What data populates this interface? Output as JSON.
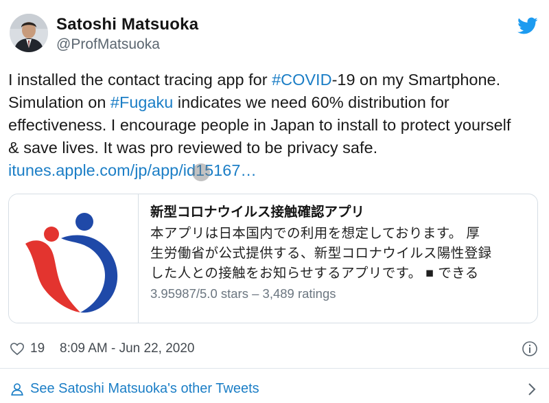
{
  "author": {
    "name": "Satoshi Matsuoka",
    "handle": "@ProfMatsuoka"
  },
  "header_icon": "twitter-bird-icon",
  "tweet": {
    "line1": {
      "pre": "I installed the contact tracing app for ",
      "tag": "#COVID",
      "post": "-19 on my Smartphone."
    },
    "line2": {
      "pre": "Simulation on ",
      "tag": "#Fugaku",
      "post": " indicates we need 60% distribution for"
    },
    "line3": "effectiveness. I encourage people in Japan to install to protect yourself",
    "line4": "& save lives. It was pro reviewed to be privacy safe.",
    "link": "itunes.apple.com/jp/app/id15167…"
  },
  "card": {
    "title": "新型コロナウイルス接触確認アプリ",
    "description_lines": [
      "本アプリは日本国内での利用を想定しております。 厚",
      "生労働省が公式提供する、新型コロナウイルス陽性登録",
      "した人との接触をお知らせするアプリです。 ■ できる"
    ],
    "rating": "3.95987/5.0 stars – 3,489 ratings",
    "thumbnail_icon": "cocoa-heart-logo-icon"
  },
  "footer": {
    "likes": "19",
    "timestamp": "8:09 AM - Jun 22, 2020",
    "see_more": "See Satoshi Matsuoka's other Tweets"
  },
  "colors": {
    "link": "#1b7ec6",
    "text": "#1a1a1a",
    "muted": "#5b6670",
    "logo_red": "#e3342f",
    "logo_blue": "#1f49a8"
  }
}
